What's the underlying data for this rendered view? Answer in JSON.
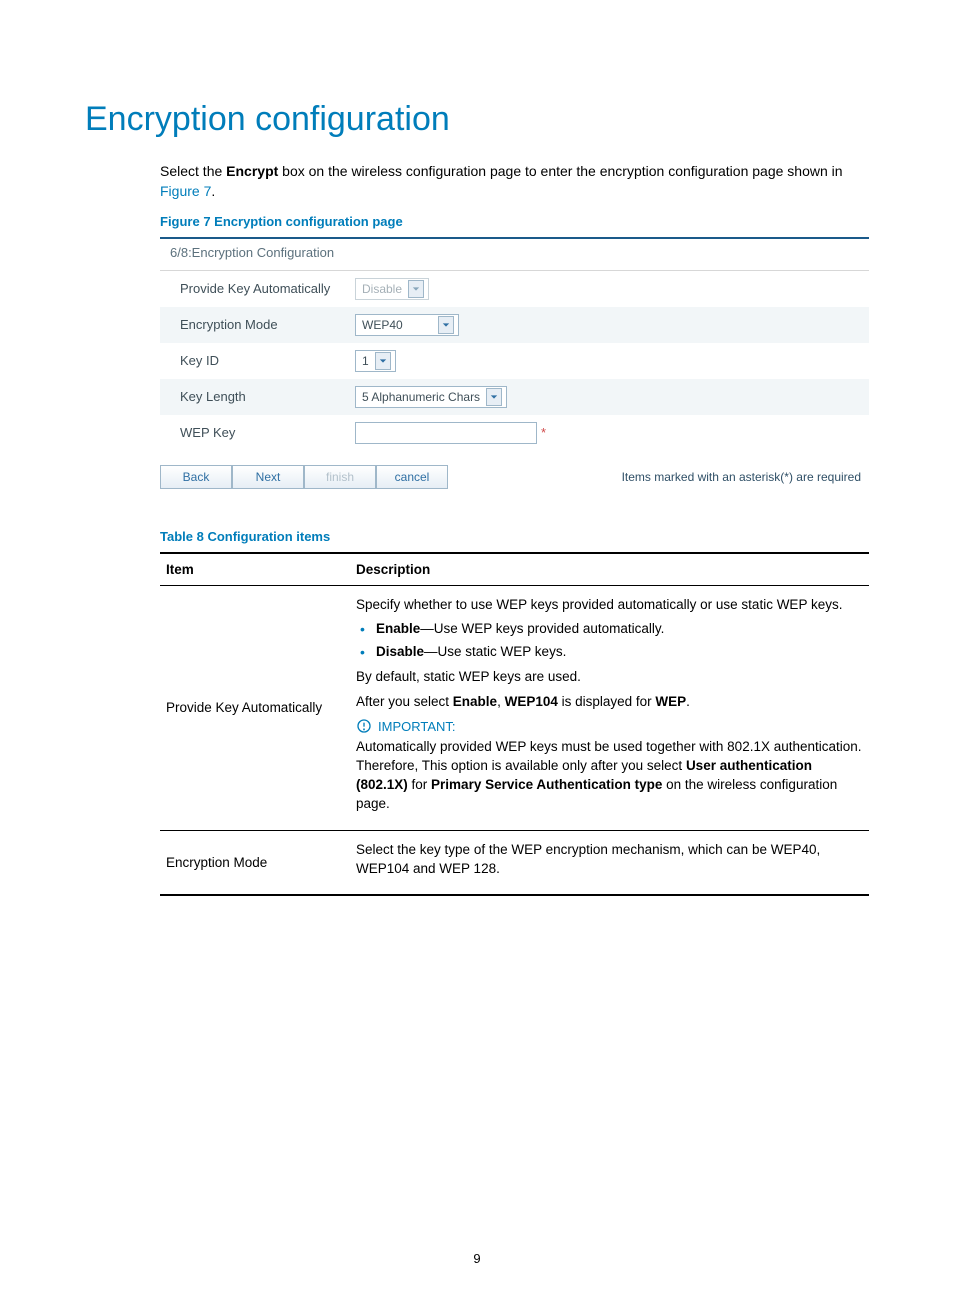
{
  "heading": "Encryption configuration",
  "intro": {
    "pre": "Select the ",
    "bold": "Encrypt",
    "post": " box on the wireless configuration page to enter the encryption configuration page shown in ",
    "link": "Figure 7",
    "end": "."
  },
  "figure_caption": "Figure 7 Encryption configuration page",
  "figure": {
    "step_header": "6/8:Encryption Configuration",
    "rows": {
      "provide_key_auto": {
        "label": "Provide Key Automatically",
        "value": "Disable"
      },
      "encryption_mode": {
        "label": "Encryption Mode",
        "value": "WEP40"
      },
      "key_id": {
        "label": "Key ID",
        "value": "1"
      },
      "key_length": {
        "label": "Key Length",
        "value": "5 Alphanumeric Chars"
      },
      "wep_key": {
        "label": "WEP Key",
        "asterisk": "*"
      }
    },
    "buttons": {
      "back": "Back",
      "next": "Next",
      "finish": "finish",
      "cancel": "cancel"
    },
    "required_note": "Items marked with an asterisk(*) are required"
  },
  "table_caption": "Table 8 Configuration items",
  "table": {
    "head_item": "Item",
    "head_desc": "Description",
    "r1_item": "Provide Key Automatically",
    "r1_p1": "Specify whether to use WEP keys provided automatically or use static WEP keys.",
    "r1_li1_b": "Enable",
    "r1_li1_t": "—Use WEP keys provided automatically.",
    "r1_li2_b": "Disable",
    "r1_li2_t": "—Use static WEP keys.",
    "r1_p2": "By default, static WEP keys are used.",
    "r1_p3_a": "After you select ",
    "r1_p3_b1": "Enable",
    "r1_p3_m": ", ",
    "r1_p3_b2": "WEP104",
    "r1_p3_c": " is displayed for ",
    "r1_p3_b3": "WEP",
    "r1_p3_e": ".",
    "r1_imp_label": "IMPORTANT:",
    "r1_imp_a": "Automatically provided WEP keys must be used together with 802.1X authentication. Therefore, This option is available only after you select ",
    "r1_imp_b1": "User authentication (802.1X)",
    "r1_imp_m": " for ",
    "r1_imp_b2": "Primary Service Authentication type",
    "r1_imp_e": " on the wireless configuration page.",
    "r2_item": "Encryption Mode",
    "r2_p": "Select the key type of the WEP encryption mechanism, which can be WEP40, WEP104 and WEP 128."
  },
  "page_number": "9"
}
